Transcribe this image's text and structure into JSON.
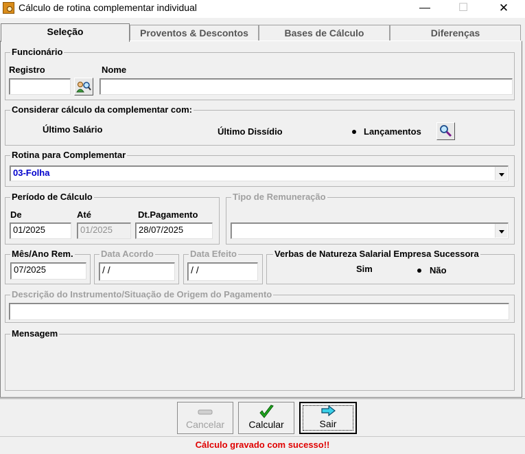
{
  "window": {
    "title": "Cálculo de rotina complementar individual",
    "minimize": "—",
    "maximize": "☐",
    "close": "✕"
  },
  "tabs": [
    {
      "label": "Seleção"
    },
    {
      "label": "Proventos & Descontos"
    },
    {
      "label": "Bases de Cálculo"
    },
    {
      "label": "Diferenças"
    }
  ],
  "funcionario": {
    "legend": "Funcionário",
    "registro_label": "Registro",
    "registro_value": "",
    "nome_label": "Nome",
    "nome_value": ""
  },
  "considerar": {
    "legend": "Considerar cálculo da complementar com:",
    "options": [
      {
        "label": "Último Salário",
        "selected": false
      },
      {
        "label": "Último Dissídio",
        "selected": false
      },
      {
        "label": "Lançamentos",
        "selected": true
      }
    ]
  },
  "rotina": {
    "legend": "Rotina para Complementar",
    "value": "03-Folha",
    "value_color": "#0000cc"
  },
  "periodo": {
    "legend": "Período de Cálculo",
    "de_label": "De",
    "de_value": "01/2025",
    "ate_label": "Até",
    "ate_value": "01/2025",
    "pagamento_label": "Dt.Pagamento",
    "pagamento_value": "28/07/2025"
  },
  "tipo_remuneracao": {
    "legend": "Tipo de Remuneração",
    "value": ""
  },
  "mes_ano": {
    "legend": "Mês/Ano Rem.",
    "value": "07/2025"
  },
  "data_acordo": {
    "legend": "Data Acordo",
    "value": " / /"
  },
  "data_efeito": {
    "legend": "Data Efeito",
    "value": " / /"
  },
  "verbas": {
    "legend": "Verbas de Natureza Salarial Empresa Sucessora",
    "options": [
      {
        "label": "Sim",
        "selected": false
      },
      {
        "label": "Não",
        "selected": true
      }
    ]
  },
  "descricao": {
    "legend": "Descrição do Instrumento/Situação de Origem do Pagamento",
    "value": ""
  },
  "mensagem": {
    "legend": "Mensagem",
    "value": ""
  },
  "buttons": {
    "cancelar": "Cancelar",
    "calcular": "Calcular",
    "sair": "Sair"
  },
  "status": {
    "text": "Cálculo gravado com sucesso!!",
    "color": "#e00000"
  },
  "icons": {
    "app": "app-icon",
    "search_people": "people-search-icon",
    "search": "magnifier-icon",
    "cancel": "cancel-icon",
    "check": "checkmark-icon",
    "exit": "arrow-right-icon"
  }
}
